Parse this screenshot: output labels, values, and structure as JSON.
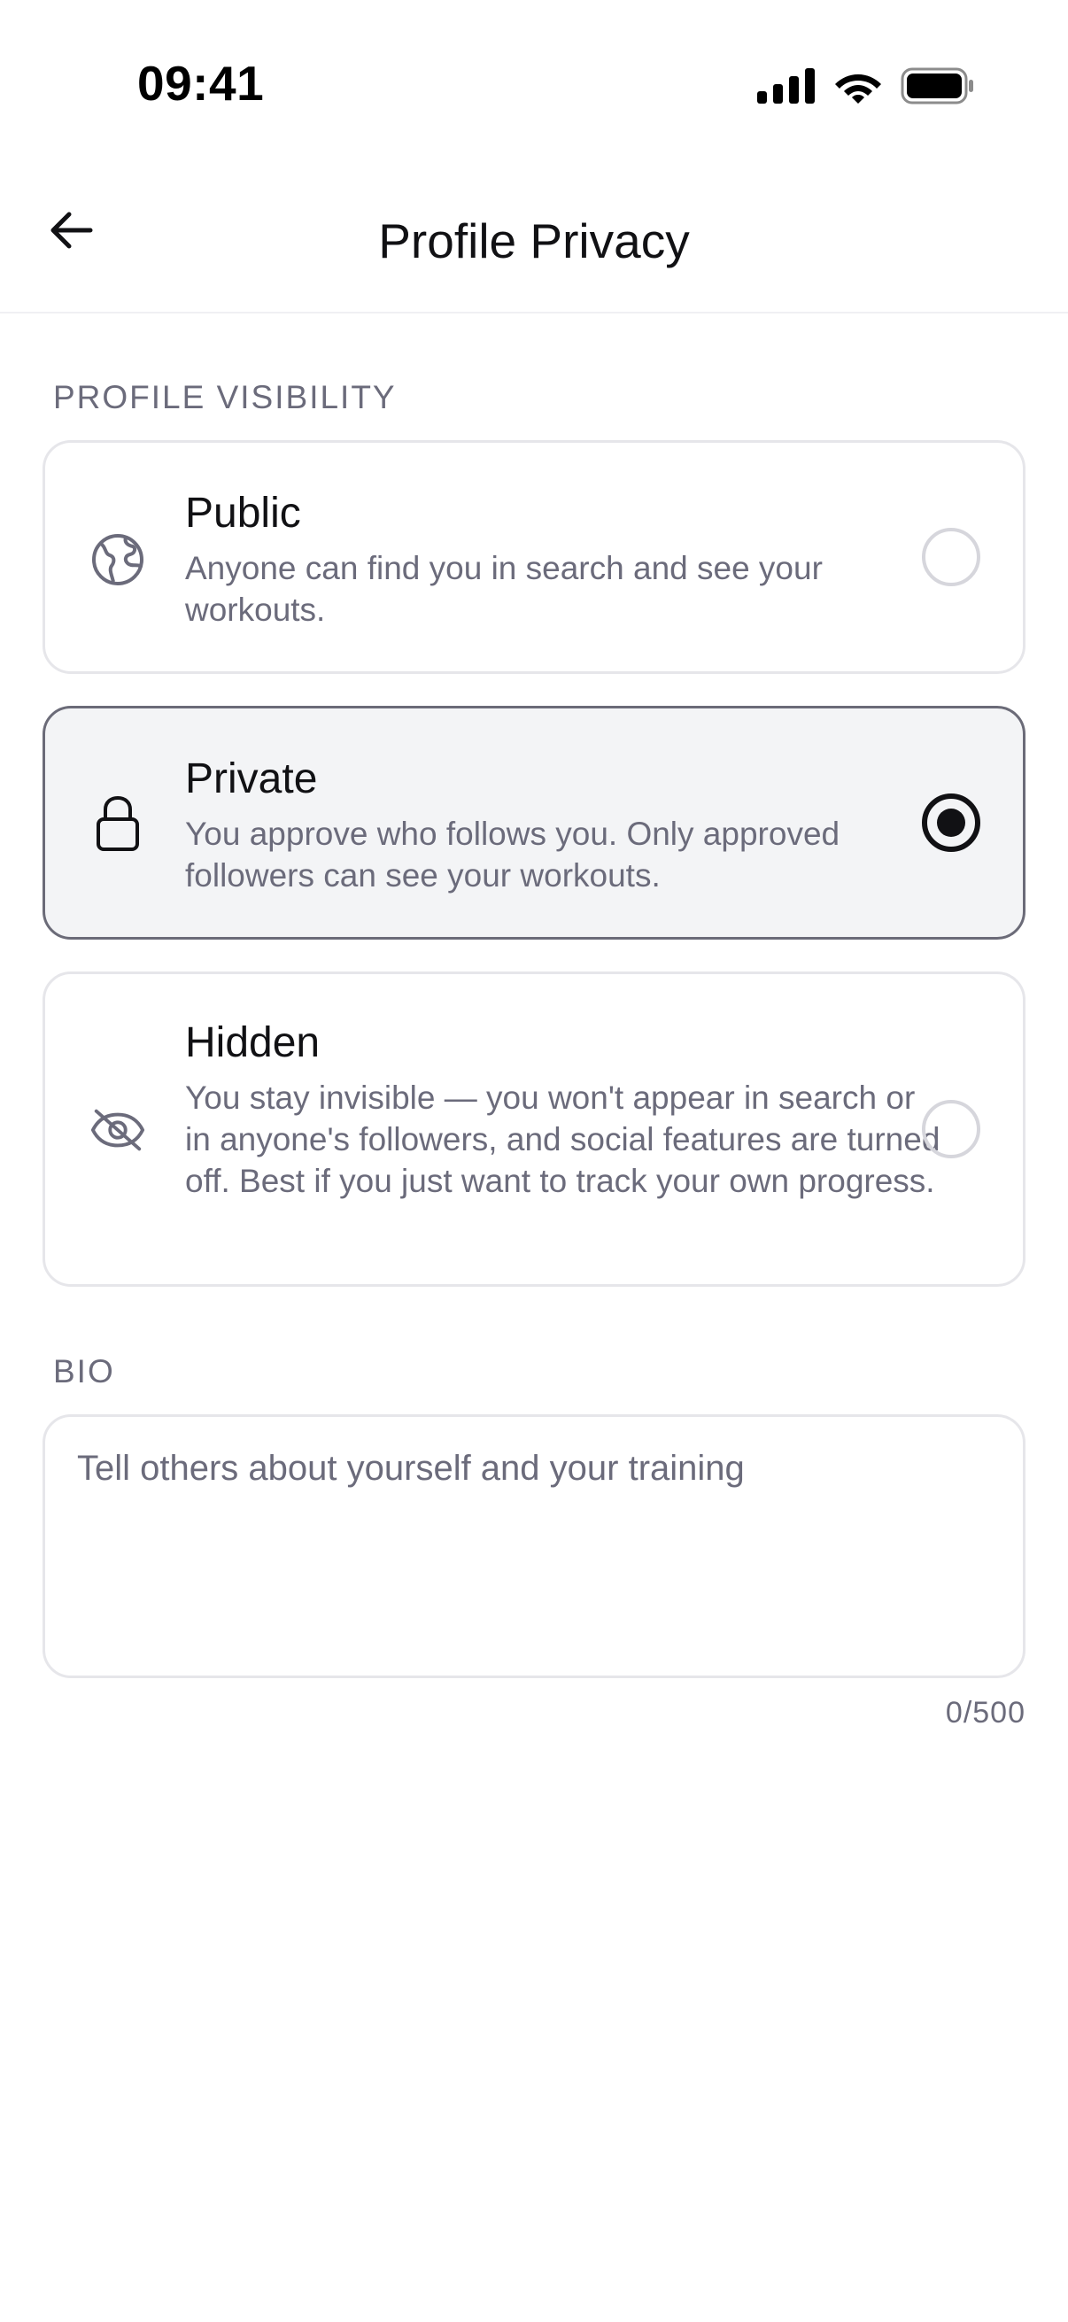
{
  "status_bar": {
    "time": "09:41"
  },
  "header": {
    "title": "Profile Privacy",
    "back_icon": "arrow-left-icon"
  },
  "visibility": {
    "section_label": "PROFILE VISIBILITY",
    "selected": "private",
    "options": [
      {
        "id": "public",
        "icon": "globe-icon",
        "title": "Public",
        "description": "Anyone can find you in search and see your workouts."
      },
      {
        "id": "private",
        "icon": "lock-icon",
        "title": "Private",
        "description": "You approve who follows you. Only approved followers can see your workouts."
      },
      {
        "id": "hidden",
        "icon": "eye-off-icon",
        "title": "Hidden",
        "description": "You stay invisible — you won't appear in search or in anyone's followers, and social features are turned off. Best if you just want to track your own progress."
      }
    ]
  },
  "bio": {
    "section_label": "BIO",
    "placeholder": "Tell others about yourself and your training",
    "value": "",
    "counter": "0/500"
  },
  "colors": {
    "text_primary": "#111114",
    "text_secondary": "#6b6b7b",
    "card_border": "#e6e6ea",
    "selected_background": "#f3f4f6",
    "selected_border": "#6b6b78"
  }
}
